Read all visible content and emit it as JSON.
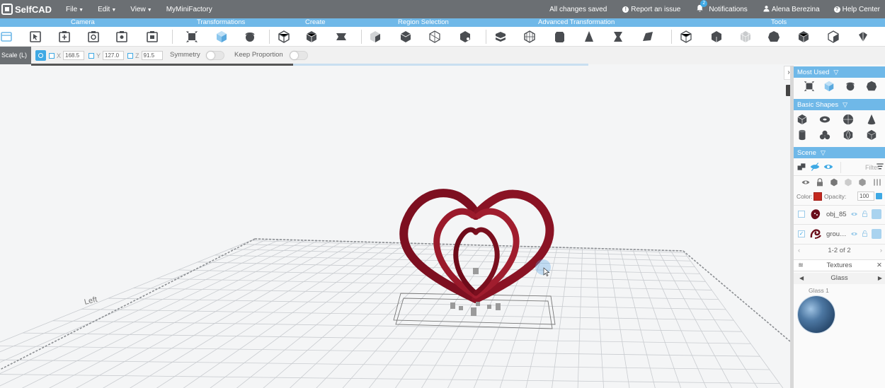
{
  "app": {
    "name": "SelfCAD",
    "menu": [
      {
        "label": "File"
      },
      {
        "label": "Edit"
      },
      {
        "label": "View"
      },
      {
        "label": "MyMiniFactory"
      }
    ],
    "status": "All changes saved",
    "report_issue": "Report an issue",
    "notifications": "Notifications",
    "notification_count": "2",
    "user_name": "Alena Berezina",
    "help_center": "Help Center"
  },
  "sections": [
    {
      "label": "Camera"
    },
    {
      "label": "Transformations"
    },
    {
      "label": "Create"
    },
    {
      "label": "Region Selection"
    },
    {
      "label": "Advanced Transformation"
    },
    {
      "label": "Tools"
    }
  ],
  "options": {
    "mode": "Scale (L)",
    "x_label": "X",
    "x_value": "168.5",
    "y_label": "Y",
    "y_value": "127.0",
    "z_label": "Z",
    "z_value": "91.5",
    "symmetry": "Symmetry",
    "keep_proportion": "Keep Proportion",
    "progress_fraction": 0.47
  },
  "viewport": {
    "axis_label": "Left",
    "object_color": "#8f1326"
  },
  "panel": {
    "most_used": "Most Used",
    "basic_shapes": "Basic Shapes",
    "scene": "Scene",
    "filter_placeholder": "Filter",
    "color_label": "Color:",
    "object_color": "#c4291f",
    "opacity_label": "Opacity:",
    "opacity_value": "100",
    "objects": [
      {
        "name": "obj_85",
        "checked": false
      },
      {
        "name": "grou…",
        "checked": true
      }
    ],
    "pager": "1-2 of 2",
    "textures": "Textures",
    "texture_category": "Glass",
    "texture_item": "Glass 1"
  },
  "colors": {
    "accent": "#6fb8e8",
    "topbar": "#6b6f73",
    "toolbar_icon": "#4a4d51"
  }
}
